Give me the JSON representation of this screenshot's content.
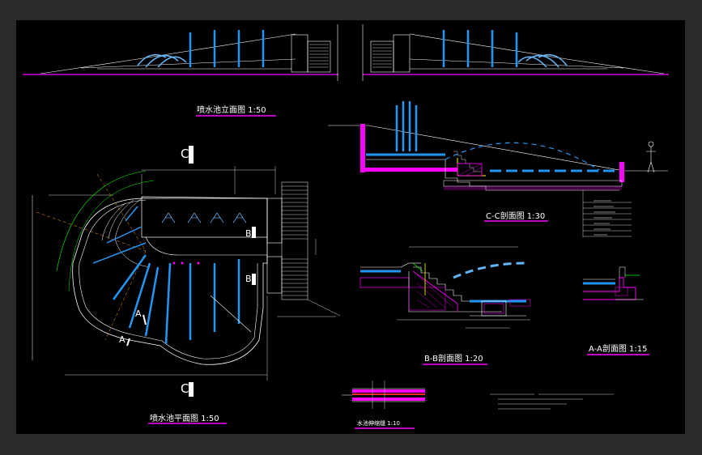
{
  "drawing": {
    "titles": {
      "elevation": "喷水池立面图   1:50",
      "plan": "喷水池平面图   1:50",
      "section_cc": "C-C剖面图   1:30",
      "section_bb": "B-B剖面图   1:20",
      "section_aa": "A-A剖面图   1:15",
      "joint_detail": "水池伸缩缝   1:10"
    },
    "section_marks": {
      "c": "C",
      "b": "B",
      "a": "A"
    },
    "colors": {
      "background": "#000000",
      "workspace": "#2a2a2d",
      "line": "#ffffff",
      "water": "#2196f3",
      "water_light": "#64b5f6",
      "magenta": "#ff00ff",
      "green": "#00ff00",
      "yellow": "#ffff00",
      "red": "#ff2a2a",
      "cyan": "#00ffff"
    }
  }
}
